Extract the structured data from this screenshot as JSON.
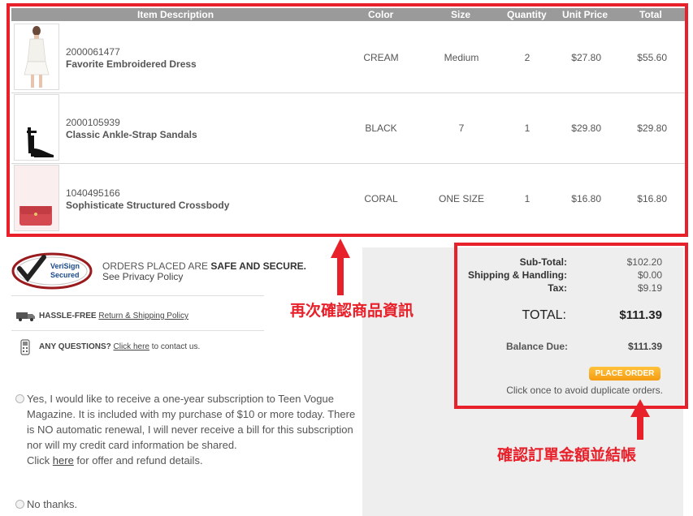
{
  "table": {
    "headers": {
      "item": "Item Description",
      "color": "Color",
      "size": "Size",
      "quantity": "Quantity",
      "unit_price": "Unit Price",
      "total": "Total"
    },
    "rows": [
      {
        "sku": "2000061477",
        "name": "Favorite Embroidered Dress",
        "color": "CREAM",
        "size": "Medium",
        "qty": "2",
        "unit": "$27.80",
        "total": "$55.60"
      },
      {
        "sku": "2000105939",
        "name": "Classic Ankle-Strap Sandals",
        "color": "BLACK",
        "size": "7",
        "qty": "1",
        "unit": "$29.80",
        "total": "$29.80"
      },
      {
        "sku": "1040495166",
        "name": "Sophisticate Structured Crossbody",
        "color": "CORAL",
        "size": "ONE SIZE",
        "qty": "1",
        "unit": "$16.80",
        "total": "$16.80"
      }
    ]
  },
  "trust": {
    "verisign_line1": "VeriSign",
    "verisign_line2": "Secured",
    "orders_prefix": "ORDERS PLACED ARE ",
    "orders_bold": "SAFE AND SECURE.",
    "privacy_link": "See Privacy Policy",
    "hassle_bold": "HASSLE-FREE",
    "return_link": "Return & Shipping Policy",
    "questions_bold": "ANY QUESTIONS?",
    "click_here": "Click here",
    "contact_suffix": " to contact us."
  },
  "subscription": {
    "yes_text": "Yes, I would like to receive a one-year subscription to Teen Vogue Magazine. It is included with my purchase of $10 or more today. There is NO automatic renewal, I will never receive a bill for this subscription nor will my credit card information be shared.",
    "click_prefix": "Click ",
    "here_link": "here",
    "click_suffix": " for offer and refund details.",
    "no_text": "No thanks."
  },
  "summary": {
    "subtotal_label": "Sub-Total:",
    "subtotal_value": "$102.20",
    "shipping_label": "Shipping & Handling:",
    "shipping_value": "$0.00",
    "tax_label": "Tax:",
    "tax_value": "$9.19",
    "total_label": "TOTAL:",
    "total_value": "$111.39",
    "balance_label": "Balance Due:",
    "balance_value": "$111.39",
    "place_order": "PLACE ORDER",
    "duplicate_note": "Click once to avoid duplicate orders."
  },
  "annotations": {
    "items_note": "再次確認商品資訊",
    "checkout_note": "確認訂單金額並結帳"
  },
  "colors": {
    "annotation_red": "#e8202a",
    "header_gray": "#9a9a9a",
    "button_orange": "#f5a41e"
  }
}
